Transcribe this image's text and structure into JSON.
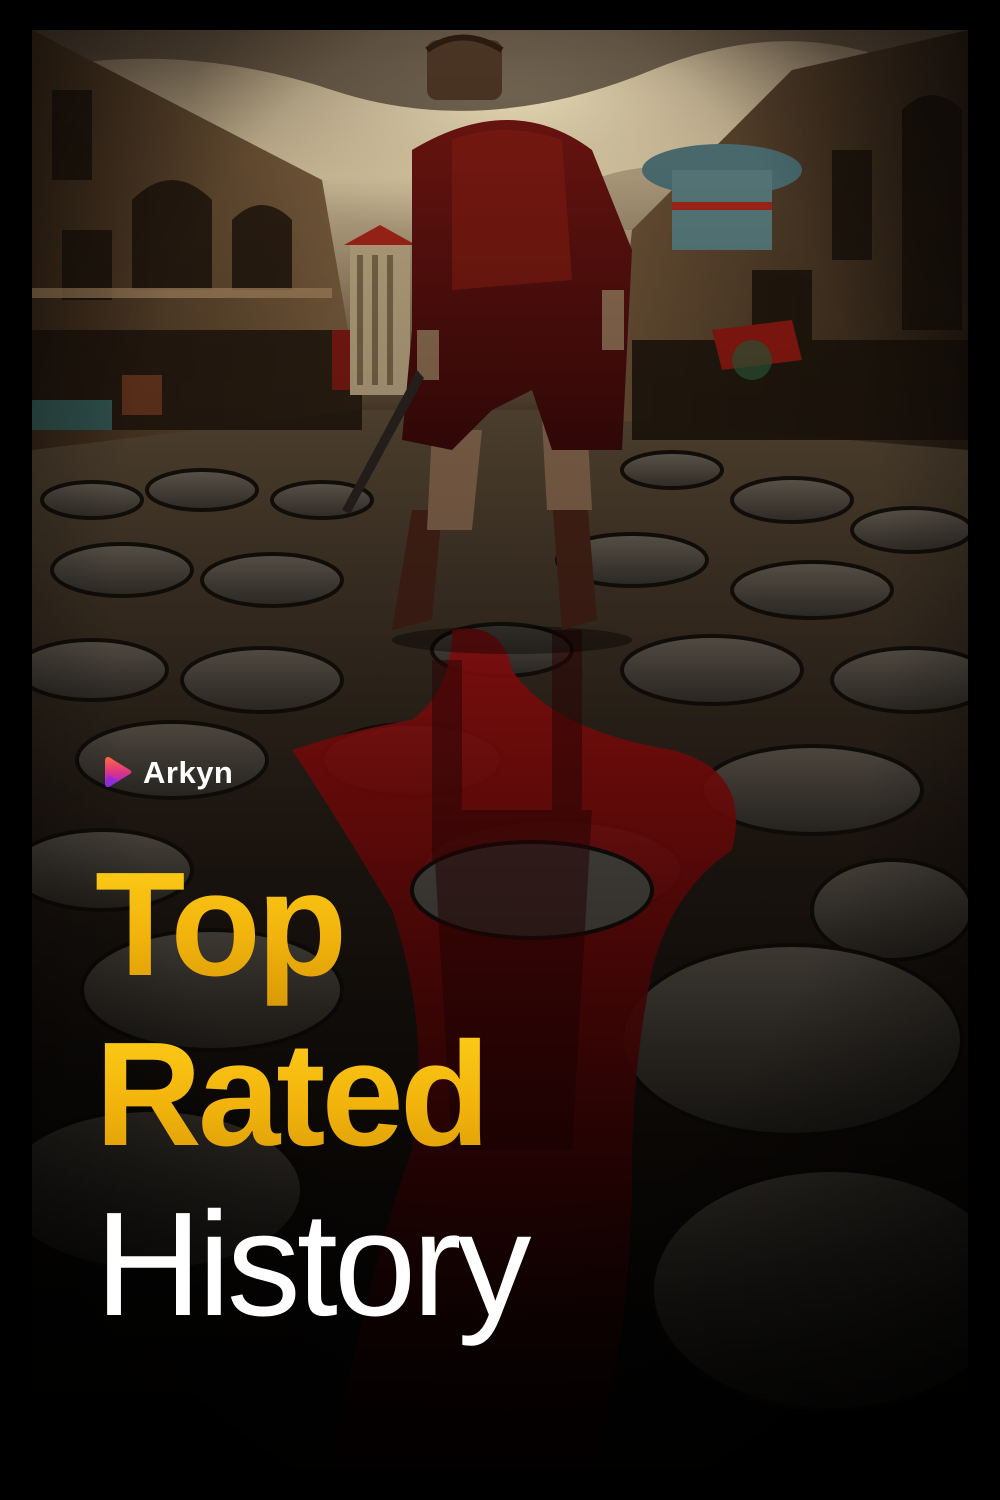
{
  "brand": {
    "name": "Arkyn",
    "icon": "arkyn-logo-icon",
    "gradient_start": "#ff6a3d",
    "gradient_end": "#8a2be2"
  },
  "headline": {
    "line1": "Top",
    "line2": "Rated",
    "line3": "History"
  },
  "colors": {
    "frame": "#000000",
    "headline_gold": "#f2b40c",
    "headline_white": "#ffffff",
    "blood_red": "#8a0a0a"
  },
  "artwork": {
    "subject_icon": "roman-soldier-on-cobblestone-street-icon"
  }
}
